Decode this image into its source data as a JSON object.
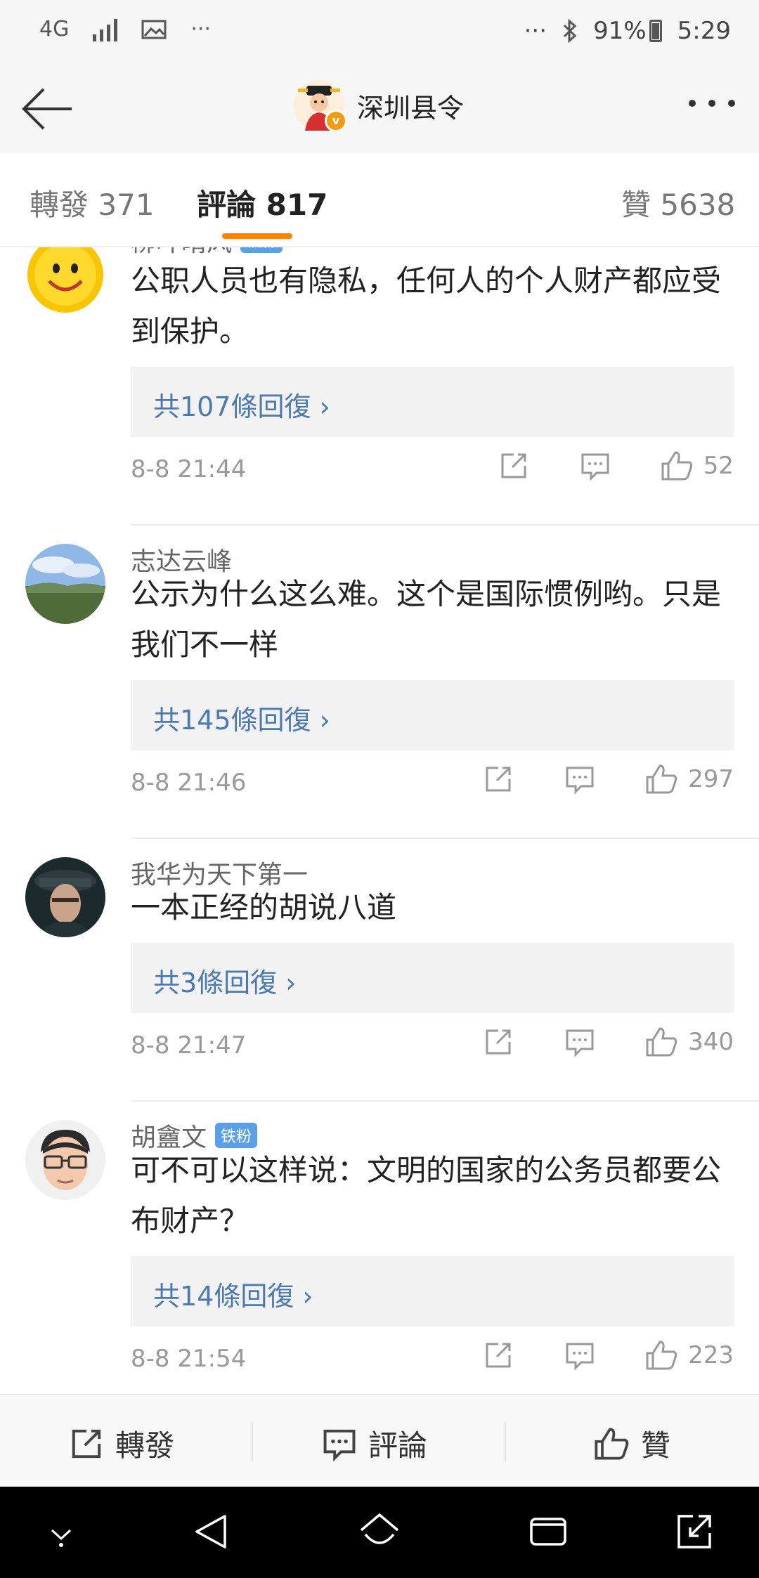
{
  "status_bar": {
    "network": "4G",
    "overflow": "···",
    "right_overflow": "···",
    "battery": "91%",
    "time": "5:29"
  },
  "header": {
    "title": "深圳县令"
  },
  "tabs": [
    {
      "label": "轉發",
      "count": "371"
    },
    {
      "label": "評論",
      "count": "817"
    },
    {
      "label": "贊",
      "count": "5638"
    }
  ],
  "comments": [
    {
      "user": "柳叶晴风",
      "badge": "铁粉",
      "text": "公职人员也有隐私，任何人的个人财产都应受到保护。",
      "replies": "共107條回復 ›",
      "time": "8-8 21:44",
      "likes": "52"
    },
    {
      "user": "志达云峰",
      "badge": "",
      "text": "公示为什么这么难。这个是国际惯例哟。只是我们不一样",
      "replies": "共145條回復 ›",
      "time": "8-8 21:46",
      "likes": "297"
    },
    {
      "user": "我华为天下第一",
      "badge": "",
      "text": "一本正经的胡说八道",
      "replies": "共3條回復 ›",
      "time": "8-8 21:47",
      "likes": "340"
    },
    {
      "user": "胡盦文",
      "badge": "铁粉",
      "text": "可不可以这样说：文明的国家的公务员都要公布财产？",
      "replies": "共14條回復 ›",
      "time": "8-8 21:54",
      "likes": "223"
    }
  ],
  "bottom_bar": {
    "repost": "轉發",
    "comment": "評論",
    "like": "贊"
  },
  "colors": {
    "accent": "#ff8200",
    "link": "#4a7ab0",
    "fan_badge": "#5aa0e8"
  }
}
